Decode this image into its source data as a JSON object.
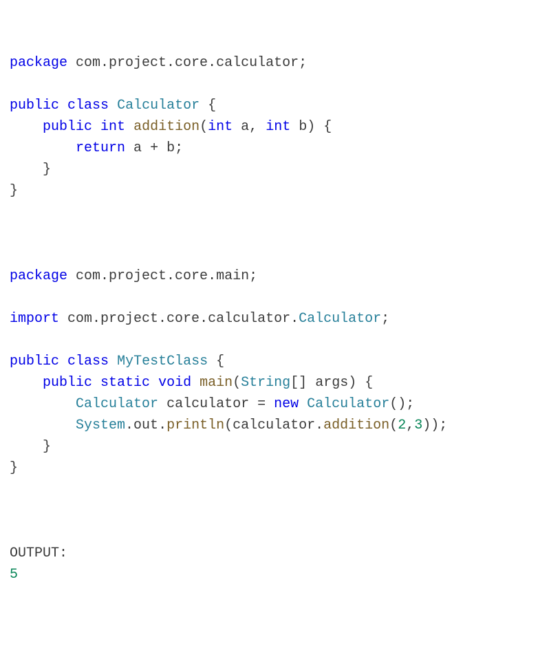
{
  "file1": {
    "pkg_kw": "package",
    "pkg_path": "com.project.core.calculator",
    "public_kw": "public",
    "class_kw": "class",
    "class_name": "Calculator",
    "int_kw": "int",
    "method_name": "addition",
    "param_a": "a",
    "param_b": "b",
    "return_kw": "return",
    "plus": "+"
  },
  "file2": {
    "pkg_kw": "package",
    "pkg_path": "com.project.core.main",
    "import_kw": "import",
    "import_path": "com.project.core.calculator.",
    "import_class": "Calculator",
    "public_kw": "public",
    "class_kw": "class",
    "class_name": "MyTestClass",
    "static_kw": "static",
    "void_kw": "void",
    "main_name": "main",
    "string_type": "String",
    "args_name": "args",
    "calc_type": "Calculator",
    "calc_var": "calculator",
    "new_kw": "new",
    "calc_ctor": "Calculator",
    "system": "System",
    "out": "out",
    "println": "println",
    "addition_call": "addition",
    "arg1": "2",
    "arg2": "3"
  },
  "output": {
    "label": "OUTPUT:",
    "value": "5"
  }
}
